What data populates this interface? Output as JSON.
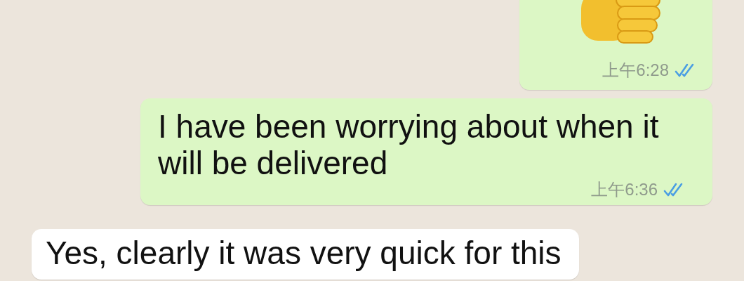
{
  "messages": [
    {
      "kind": "emoji",
      "outgoing": true,
      "time": "上午6:28",
      "read": true
    },
    {
      "kind": "text",
      "outgoing": true,
      "text": "I have been worrying about when it will be delivered",
      "time": "上午6:36",
      "read": true
    },
    {
      "kind": "text",
      "outgoing": false,
      "text": "Yes, clearly it was very quick for this"
    }
  ]
}
